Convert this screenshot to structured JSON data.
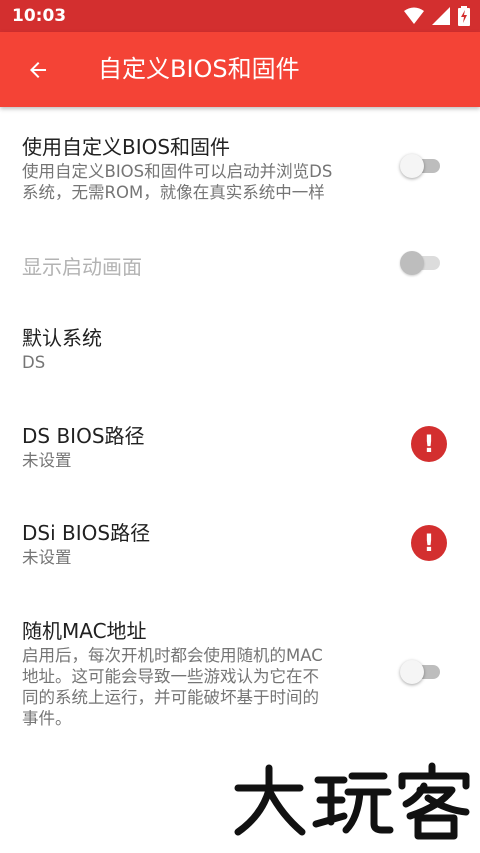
{
  "status": {
    "time": "10:03"
  },
  "appbar": {
    "title": "自定义BIOS和固件"
  },
  "prefs": [
    {
      "title": "使用自定义BIOS和固件",
      "summary_line1": "使用自定义BIOS和固件可以启动并浏览DS",
      "summary_line2": "系统，无需ROM，就像在真实系统中一样",
      "switch_on": false
    },
    {
      "title": "显示启动画面",
      "enabled": false,
      "switch_on": false
    },
    {
      "title": "默认系统",
      "summary": "DS"
    },
    {
      "title": "DS BIOS路径",
      "summary": "未设置",
      "warning": true
    },
    {
      "title": "DSi BIOS路径",
      "summary": "未设置",
      "warning": true
    },
    {
      "title": "随机MAC地址",
      "summary_line1": "启用后，每次开机时都会使用随机的MAC",
      "summary_line2": "地址。这可能会导致一些游戏认为它在不",
      "summary_line3": "同的系统上运行，并可能破坏基于时间的",
      "summary_line4": "事件。",
      "switch_on": false
    }
  ],
  "icons": {
    "back": "arrow-back-icon",
    "warning": "error-icon",
    "wifi": "wifi-icon",
    "signal": "cell-signal-icon",
    "battery": "battery-charging-icon"
  },
  "watermark": {
    "text": "大玩客"
  },
  "colors": {
    "primary": "#F44336",
    "primary_dark": "#D32F2F",
    "text": "#212121",
    "secondary_text": "#757575",
    "error": "#D32F2F"
  }
}
